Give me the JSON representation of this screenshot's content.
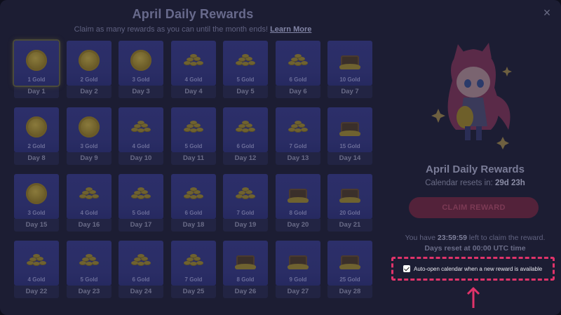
{
  "header": {
    "title": "April Daily Rewards",
    "subtitle": "Claim as many rewards as you can until the month ends!",
    "learn_more": "Learn More"
  },
  "close_label": "×",
  "rewards": [
    {
      "amount": "1 Gold",
      "day": "Day 1",
      "icon": "coin-icon"
    },
    {
      "amount": "2 Gold",
      "day": "Day 2",
      "icon": "coin-icon"
    },
    {
      "amount": "3 Gold",
      "day": "Day 3",
      "icon": "coin-icon"
    },
    {
      "amount": "4 Gold",
      "day": "Day 4",
      "icon": "gold-pile-icon"
    },
    {
      "amount": "5 Gold",
      "day": "Day 5",
      "icon": "gold-pile-icon"
    },
    {
      "amount": "6 Gold",
      "day": "Day 6",
      "icon": "gold-pile-icon"
    },
    {
      "amount": "10 Gold",
      "day": "Day 7",
      "icon": "treasure-chest-icon"
    },
    {
      "amount": "2 Gold",
      "day": "Day 8",
      "icon": "coin-icon"
    },
    {
      "amount": "3 Gold",
      "day": "Day 9",
      "icon": "coin-icon"
    },
    {
      "amount": "4 Gold",
      "day": "Day 10",
      "icon": "gold-pile-icon"
    },
    {
      "amount": "5 Gold",
      "day": "Day 11",
      "icon": "gold-pile-icon"
    },
    {
      "amount": "6 Gold",
      "day": "Day 12",
      "icon": "gold-pile-icon"
    },
    {
      "amount": "7 Gold",
      "day": "Day 13",
      "icon": "gold-pile-icon"
    },
    {
      "amount": "15 Gold",
      "day": "Day 14",
      "icon": "treasure-chest-icon"
    },
    {
      "amount": "3 Gold",
      "day": "Day 15",
      "icon": "coin-icon"
    },
    {
      "amount": "4 Gold",
      "day": "Day 16",
      "icon": "gold-pile-icon"
    },
    {
      "amount": "5 Gold",
      "day": "Day 17",
      "icon": "gold-pile-icon"
    },
    {
      "amount": "6 Gold",
      "day": "Day 18",
      "icon": "gold-pile-icon"
    },
    {
      "amount": "7 Gold",
      "day": "Day 19",
      "icon": "gold-pile-icon"
    },
    {
      "amount": "8 Gold",
      "day": "Day 20",
      "icon": "treasure-chest-icon"
    },
    {
      "amount": "20 Gold",
      "day": "Day 21",
      "icon": "treasure-chest-icon"
    },
    {
      "amount": "4 Gold",
      "day": "Day 22",
      "icon": "gold-pile-icon"
    },
    {
      "amount": "5 Gold",
      "day": "Day 23",
      "icon": "gold-pile-icon"
    },
    {
      "amount": "6 Gold",
      "day": "Day 24",
      "icon": "gold-pile-icon"
    },
    {
      "amount": "7 Gold",
      "day": "Day 25",
      "icon": "gold-pile-icon"
    },
    {
      "amount": "8 Gold",
      "day": "Day 26",
      "icon": "treasure-chest-icon"
    },
    {
      "amount": "9 Gold",
      "day": "Day 27",
      "icon": "treasure-chest-icon"
    },
    {
      "amount": "25 Gold",
      "day": "Day 28",
      "icon": "treasure-chest-icon"
    }
  ],
  "panel": {
    "title": "April Daily Rewards",
    "reset_prefix": "Calendar resets in:",
    "reset_value": "29d 23h",
    "claim_button": "CLAIM REWARD",
    "time_prefix": "You have",
    "time_value": "23:59:59",
    "time_suffix": "left to claim the reward.",
    "days_reset": "Days reset at 00:00 UTC time",
    "auto_open_label": "Auto-open calendar when a new reward is available",
    "auto_open_checked": true
  },
  "colors": {
    "accent": "#e0336a",
    "background": "#1c1d33",
    "card": "#2c2f6a"
  }
}
